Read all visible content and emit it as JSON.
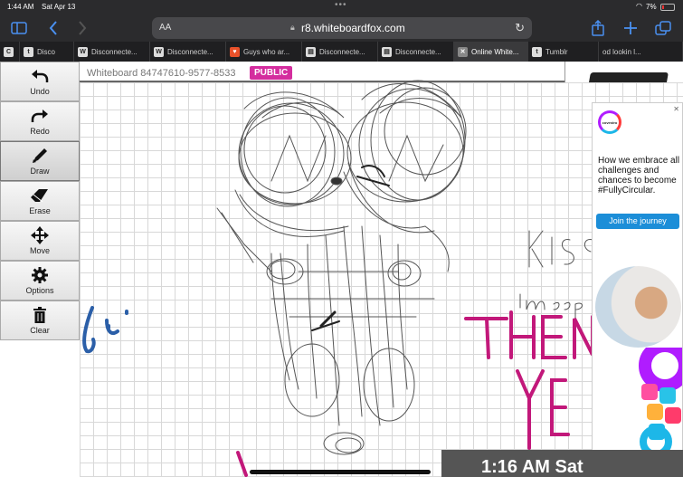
{
  "status_bar": {
    "time": "1:44 AM",
    "date": "Sat Apr 13",
    "battery": "7%"
  },
  "browser": {
    "aa_label": "AA",
    "url": "r8.whiteboardfox.com"
  },
  "tabs": [
    {
      "label": "",
      "fav": "C"
    },
    {
      "label": "Disco",
      "fav": "t"
    },
    {
      "label": "Disconnecte...",
      "fav": "W"
    },
    {
      "label": "Disconnecte...",
      "fav": "W"
    },
    {
      "label": "Guys who ar...",
      "fav": "♥"
    },
    {
      "label": "Disconnecte...",
      "fav": "▤"
    },
    {
      "label": "Disconnecte...",
      "fav": "▤"
    },
    {
      "label": "Online White...",
      "fav": "✕"
    },
    {
      "label": "Tumblr",
      "fav": "t"
    },
    {
      "label": "od lookin l...",
      "fav": ""
    }
  ],
  "board": {
    "id_text": "Whiteboard 84747610-9577-8533",
    "badge": "PUBLIC"
  },
  "tools": [
    {
      "key": "undo",
      "label": "Undo"
    },
    {
      "key": "redo",
      "label": "Redo"
    },
    {
      "key": "draw",
      "label": "Draw"
    },
    {
      "key": "erase",
      "label": "Erase"
    },
    {
      "key": "move",
      "label": "Move"
    },
    {
      "key": "options",
      "label": "Options"
    },
    {
      "key": "clear",
      "label": "Clear"
    }
  ],
  "active_tool": "draw",
  "ad": {
    "brand": "covestro",
    "headline": "How we embrace all challenges and chances to become #FullyCircular.",
    "cta": "Join the journey"
  },
  "clock_overlay": "1:16 AM   Sat",
  "colors": {
    "accent": "#4a90f0",
    "badge": "#d42d9e",
    "ink_magenta": "#c2187a",
    "ink_blue": "#2b5fa8"
  }
}
